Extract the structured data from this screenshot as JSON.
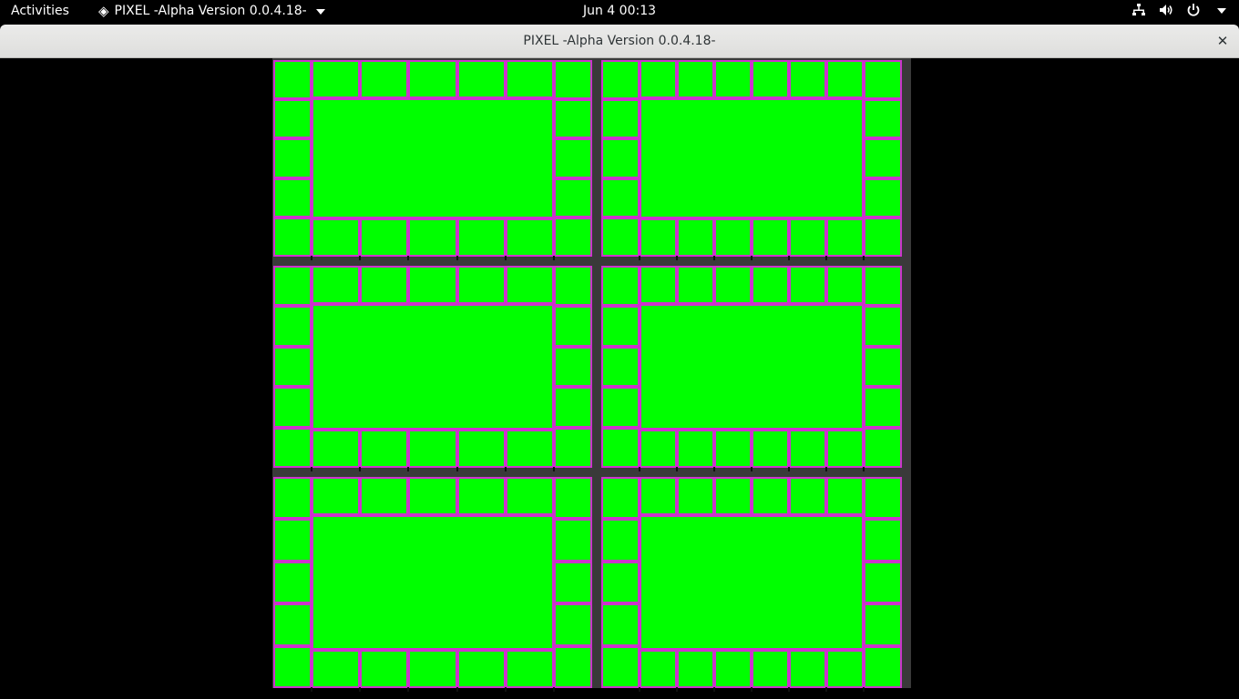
{
  "topbar": {
    "activities": "Activities",
    "app_name": "PIXEL -Alpha Version 0.0.4.18-",
    "clock": "Jun 4  00:13",
    "icons": [
      "network-wired-icon",
      "volume-icon",
      "power-icon",
      "chevron-down-icon"
    ]
  },
  "window": {
    "title": "PIXEL -Alpha Version 0.0.4.18-",
    "close_glyph": "✕"
  },
  "grid": {
    "rows": 3,
    "columns": 2,
    "left_panel_top_cells": 7,
    "right_panel_top_cells": 8,
    "side_cells_per_column": 5
  },
  "colors": {
    "cell_fill": "#00ff00",
    "cell_border": "#cc33cc",
    "canvas_background": "#3a3a3a",
    "desktop_background": "#000000"
  }
}
